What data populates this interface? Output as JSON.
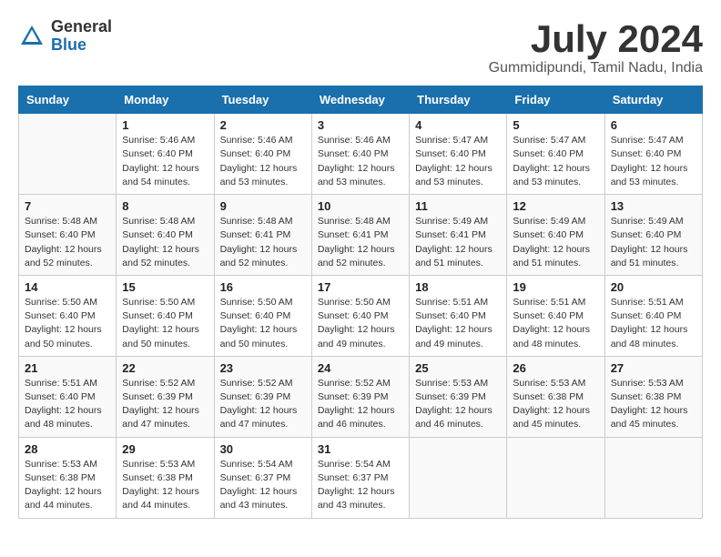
{
  "header": {
    "logo_general": "General",
    "logo_blue": "Blue",
    "title": "July 2024",
    "subtitle": "Gummidipundi, Tamil Nadu, India"
  },
  "days_of_week": [
    "Sunday",
    "Monday",
    "Tuesday",
    "Wednesday",
    "Thursday",
    "Friday",
    "Saturday"
  ],
  "weeks": [
    [
      {
        "day": "",
        "info": ""
      },
      {
        "day": "1",
        "info": "Sunrise: 5:46 AM\nSunset: 6:40 PM\nDaylight: 12 hours\nand 54 minutes."
      },
      {
        "day": "2",
        "info": "Sunrise: 5:46 AM\nSunset: 6:40 PM\nDaylight: 12 hours\nand 53 minutes."
      },
      {
        "day": "3",
        "info": "Sunrise: 5:46 AM\nSunset: 6:40 PM\nDaylight: 12 hours\nand 53 minutes."
      },
      {
        "day": "4",
        "info": "Sunrise: 5:47 AM\nSunset: 6:40 PM\nDaylight: 12 hours\nand 53 minutes."
      },
      {
        "day": "5",
        "info": "Sunrise: 5:47 AM\nSunset: 6:40 PM\nDaylight: 12 hours\nand 53 minutes."
      },
      {
        "day": "6",
        "info": "Sunrise: 5:47 AM\nSunset: 6:40 PM\nDaylight: 12 hours\nand 53 minutes."
      }
    ],
    [
      {
        "day": "7",
        "info": "Sunrise: 5:48 AM\nSunset: 6:40 PM\nDaylight: 12 hours\nand 52 minutes."
      },
      {
        "day": "8",
        "info": "Sunrise: 5:48 AM\nSunset: 6:40 PM\nDaylight: 12 hours\nand 52 minutes."
      },
      {
        "day": "9",
        "info": "Sunrise: 5:48 AM\nSunset: 6:41 PM\nDaylight: 12 hours\nand 52 minutes."
      },
      {
        "day": "10",
        "info": "Sunrise: 5:48 AM\nSunset: 6:41 PM\nDaylight: 12 hours\nand 52 minutes."
      },
      {
        "day": "11",
        "info": "Sunrise: 5:49 AM\nSunset: 6:41 PM\nDaylight: 12 hours\nand 51 minutes."
      },
      {
        "day": "12",
        "info": "Sunrise: 5:49 AM\nSunset: 6:40 PM\nDaylight: 12 hours\nand 51 minutes."
      },
      {
        "day": "13",
        "info": "Sunrise: 5:49 AM\nSunset: 6:40 PM\nDaylight: 12 hours\nand 51 minutes."
      }
    ],
    [
      {
        "day": "14",
        "info": "Sunrise: 5:50 AM\nSunset: 6:40 PM\nDaylight: 12 hours\nand 50 minutes."
      },
      {
        "day": "15",
        "info": "Sunrise: 5:50 AM\nSunset: 6:40 PM\nDaylight: 12 hours\nand 50 minutes."
      },
      {
        "day": "16",
        "info": "Sunrise: 5:50 AM\nSunset: 6:40 PM\nDaylight: 12 hours\nand 50 minutes."
      },
      {
        "day": "17",
        "info": "Sunrise: 5:50 AM\nSunset: 6:40 PM\nDaylight: 12 hours\nand 49 minutes."
      },
      {
        "day": "18",
        "info": "Sunrise: 5:51 AM\nSunset: 6:40 PM\nDaylight: 12 hours\nand 49 minutes."
      },
      {
        "day": "19",
        "info": "Sunrise: 5:51 AM\nSunset: 6:40 PM\nDaylight: 12 hours\nand 48 minutes."
      },
      {
        "day": "20",
        "info": "Sunrise: 5:51 AM\nSunset: 6:40 PM\nDaylight: 12 hours\nand 48 minutes."
      }
    ],
    [
      {
        "day": "21",
        "info": "Sunrise: 5:51 AM\nSunset: 6:40 PM\nDaylight: 12 hours\nand 48 minutes."
      },
      {
        "day": "22",
        "info": "Sunrise: 5:52 AM\nSunset: 6:39 PM\nDaylight: 12 hours\nand 47 minutes."
      },
      {
        "day": "23",
        "info": "Sunrise: 5:52 AM\nSunset: 6:39 PM\nDaylight: 12 hours\nand 47 minutes."
      },
      {
        "day": "24",
        "info": "Sunrise: 5:52 AM\nSunset: 6:39 PM\nDaylight: 12 hours\nand 46 minutes."
      },
      {
        "day": "25",
        "info": "Sunrise: 5:53 AM\nSunset: 6:39 PM\nDaylight: 12 hours\nand 46 minutes."
      },
      {
        "day": "26",
        "info": "Sunrise: 5:53 AM\nSunset: 6:38 PM\nDaylight: 12 hours\nand 45 minutes."
      },
      {
        "day": "27",
        "info": "Sunrise: 5:53 AM\nSunset: 6:38 PM\nDaylight: 12 hours\nand 45 minutes."
      }
    ],
    [
      {
        "day": "28",
        "info": "Sunrise: 5:53 AM\nSunset: 6:38 PM\nDaylight: 12 hours\nand 44 minutes."
      },
      {
        "day": "29",
        "info": "Sunrise: 5:53 AM\nSunset: 6:38 PM\nDaylight: 12 hours\nand 44 minutes."
      },
      {
        "day": "30",
        "info": "Sunrise: 5:54 AM\nSunset: 6:37 PM\nDaylight: 12 hours\nand 43 minutes."
      },
      {
        "day": "31",
        "info": "Sunrise: 5:54 AM\nSunset: 6:37 PM\nDaylight: 12 hours\nand 43 minutes."
      },
      {
        "day": "",
        "info": ""
      },
      {
        "day": "",
        "info": ""
      },
      {
        "day": "",
        "info": ""
      }
    ]
  ]
}
